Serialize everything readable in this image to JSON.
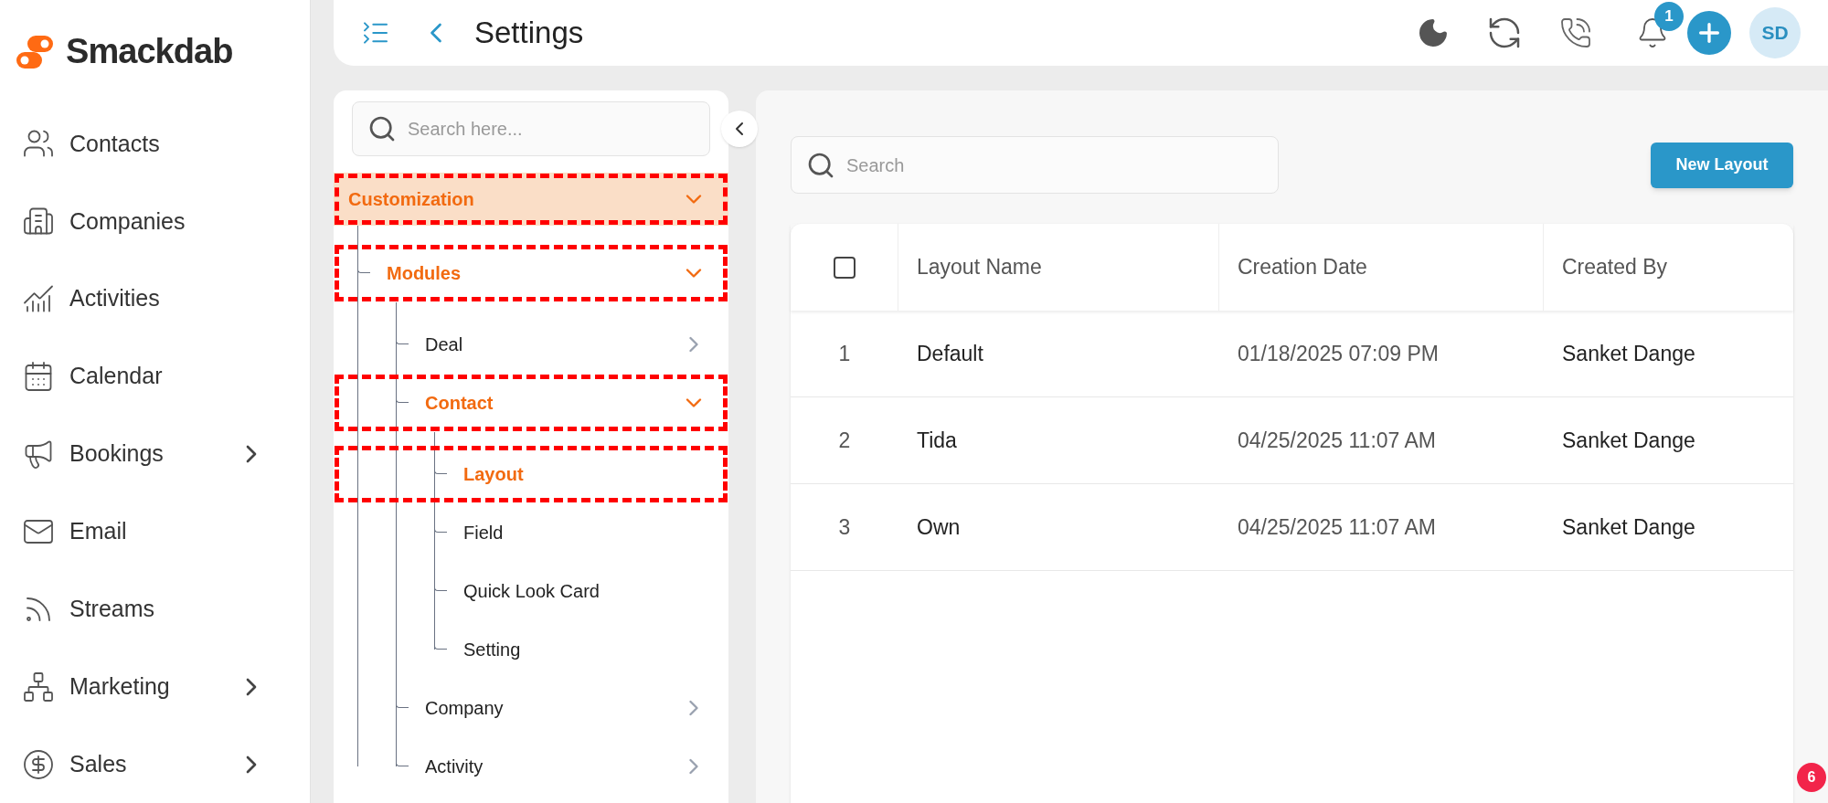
{
  "brand": {
    "name": "Smackdab"
  },
  "sidebar": {
    "items": [
      {
        "kind": "contacts",
        "label": "Contacts",
        "has_submenu": false
      },
      {
        "kind": "companies",
        "label": "Companies",
        "has_submenu": false
      },
      {
        "kind": "activities",
        "label": "Activities",
        "has_submenu": false
      },
      {
        "kind": "calendar",
        "label": "Calendar",
        "has_submenu": false
      },
      {
        "kind": "bookings",
        "label": "Bookings",
        "has_submenu": true
      },
      {
        "kind": "email",
        "label": "Email",
        "has_submenu": false
      },
      {
        "kind": "streams",
        "label": "Streams",
        "has_submenu": false
      },
      {
        "kind": "marketing",
        "label": "Marketing",
        "has_submenu": true
      },
      {
        "kind": "sales",
        "label": "Sales",
        "has_submenu": true
      }
    ]
  },
  "header": {
    "title": "Settings",
    "notification_count": "1",
    "avatar_initials": "SD"
  },
  "tree": {
    "search_placeholder": "Search here...",
    "items": [
      {
        "label": "Customization",
        "selected": true,
        "expanded": true,
        "annotated": true,
        "children": [
          {
            "label": "Modules",
            "selected": true,
            "expanded": true,
            "annotated": true,
            "children": [
              {
                "label": "Deal",
                "selected": false,
                "expanded": false,
                "annotated": false
              },
              {
                "label": "Contact",
                "selected": true,
                "expanded": true,
                "annotated": true,
                "children": [
                  {
                    "label": "Layout",
                    "selected": true,
                    "annotated": true
                  },
                  {
                    "label": "Field",
                    "selected": false,
                    "annotated": false
                  },
                  {
                    "label": "Quick Look Card",
                    "selected": false,
                    "annotated": false
                  },
                  {
                    "label": "Setting",
                    "selected": false,
                    "annotated": false
                  }
                ]
              },
              {
                "label": "Company",
                "selected": false,
                "expanded": false,
                "annotated": false
              },
              {
                "label": "Activity",
                "selected": false,
                "expanded": false,
                "annotated": false
              }
            ]
          }
        ]
      }
    ]
  },
  "content": {
    "search_placeholder": "Search",
    "new_button": "New Layout",
    "table": {
      "select_all_checked": false,
      "columns": [
        "Layout Name",
        "Creation Date",
        "Created By"
      ],
      "rows": [
        {
          "index": "1",
          "cells": [
            "Default",
            "01/18/2025 07:09 PM",
            "Sanket Dange"
          ]
        },
        {
          "index": "2",
          "cells": [
            "Tida",
            "04/25/2025 11:07 AM",
            "Sanket Dange"
          ]
        },
        {
          "index": "3",
          "cells": [
            "Own",
            "04/25/2025 11:07 AM",
            "Sanket Dange"
          ]
        }
      ]
    }
  },
  "floating_badge": "6"
}
